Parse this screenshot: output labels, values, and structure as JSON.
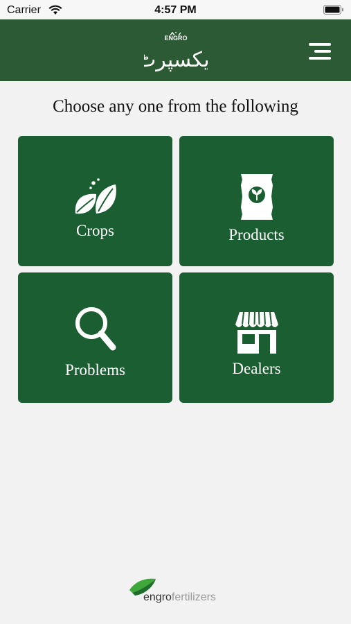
{
  "status_bar": {
    "carrier": "Carrier",
    "time": "4:57 PM"
  },
  "header": {
    "logo_brand": "ENGRO",
    "logo_script": "ایکسپرٹ",
    "menu_icon": "hamburger-menu-icon"
  },
  "main": {
    "heading": "Choose any one from the following",
    "tiles": [
      {
        "label": "Crops",
        "icon": "leaves-icon"
      },
      {
        "label": "Products",
        "icon": "fertilizer-bag-icon"
      },
      {
        "label": "Problems",
        "icon": "magnifier-icon"
      },
      {
        "label": "Dealers",
        "icon": "storefront-icon"
      }
    ]
  },
  "footer": {
    "brand_primary": "engro",
    "brand_secondary": "fertilizers"
  },
  "colors": {
    "header_bg": "#2c5a34",
    "tile_bg": "#1b5e32",
    "page_bg": "#f2f2f2"
  }
}
